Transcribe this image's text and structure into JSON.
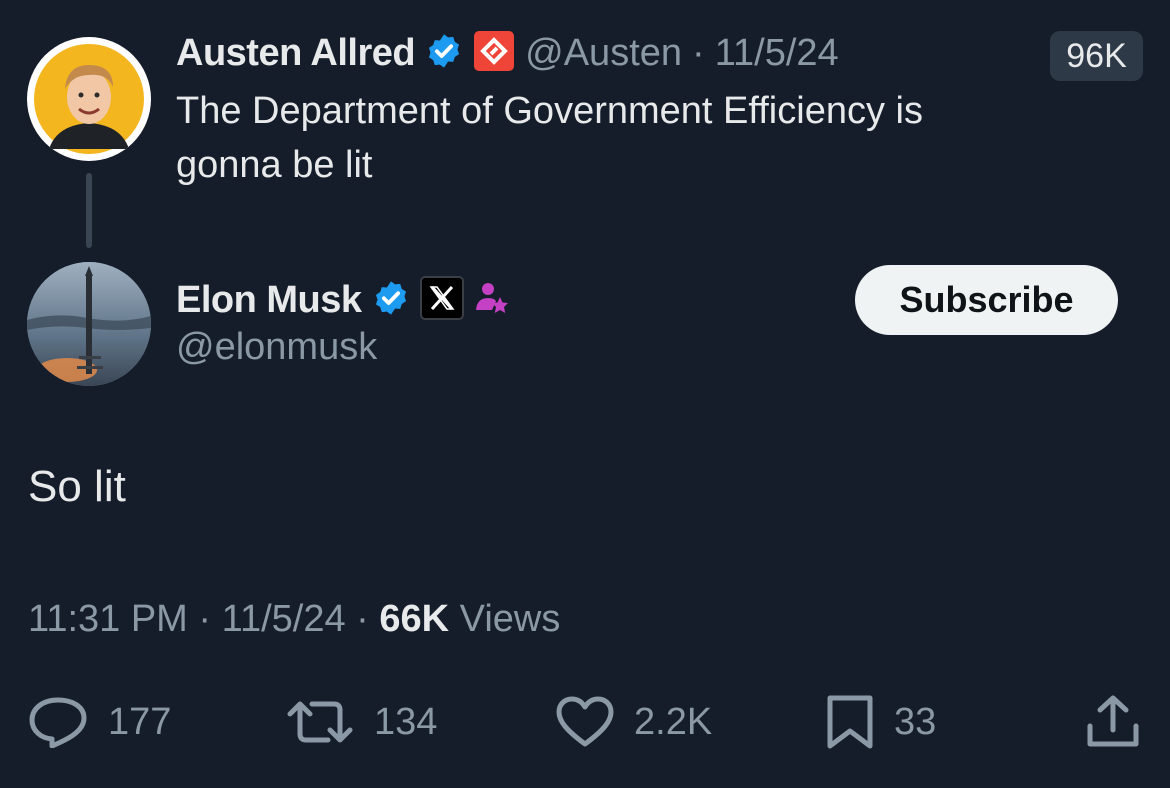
{
  "quoted_tweet": {
    "author_name": "Austen Allred",
    "handle": "@Austen",
    "separator": "·",
    "date": "11/5/24",
    "views_badge": "96K",
    "text_line1": "The Department of Government Efficiency is",
    "text_line2": "gonna be lit"
  },
  "main_tweet": {
    "author_name": "Elon Musk",
    "handle": "@elonmusk",
    "subscribe_label": "Subscribe",
    "text": "So lit",
    "time": "11:31 PM",
    "separator": "·",
    "date": "11/5/24",
    "views_count": "66K",
    "views_label": "Views"
  },
  "actions": {
    "replies": "177",
    "reposts": "134",
    "likes": "2.2K",
    "bookmarks": "33"
  },
  "colors": {
    "background": "#161d2a",
    "text": "#e7e9ea",
    "muted": "#8b98a5",
    "verified": "#1d9bf0"
  }
}
